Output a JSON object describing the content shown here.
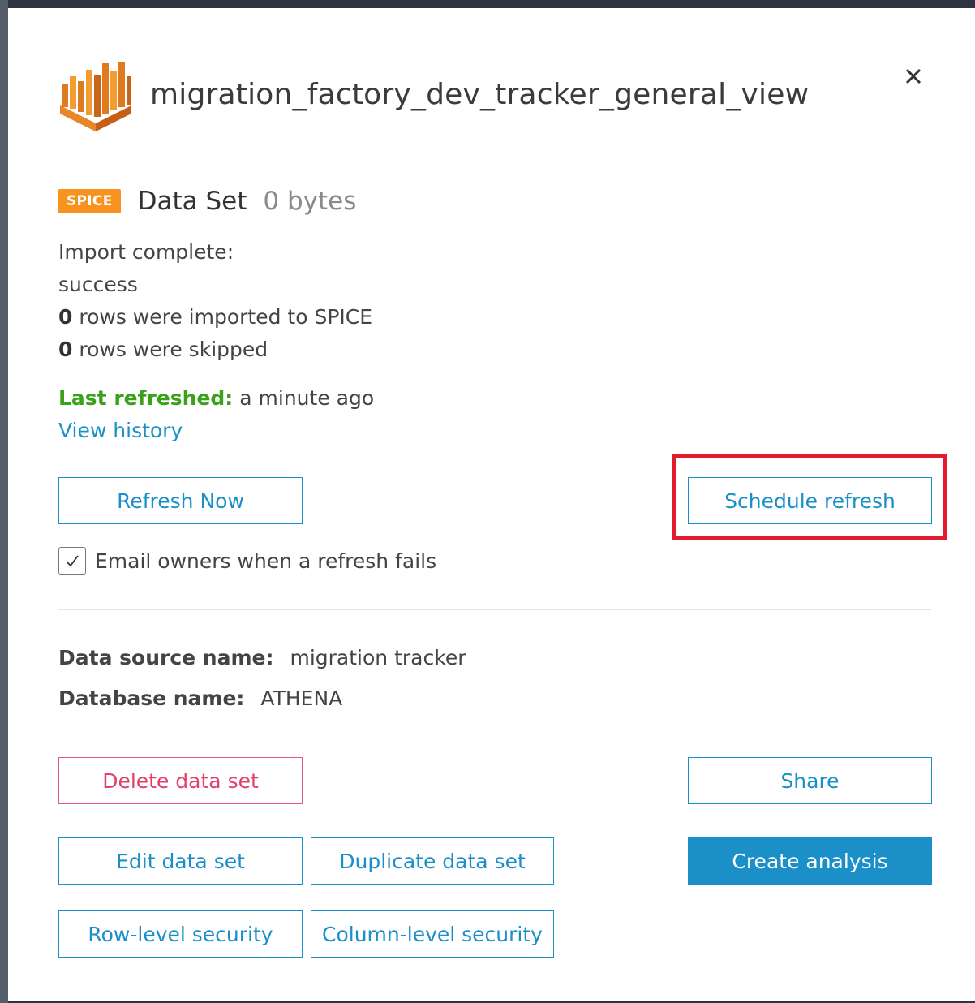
{
  "dialog": {
    "title": "migration_factory_dev_tracker_general_view",
    "close_icon": "close-icon",
    "logo_icon": "quicksight-logo-icon"
  },
  "dataset": {
    "badge": "SPICE",
    "label": "Data Set",
    "size": "0 bytes"
  },
  "import_status": {
    "heading": "Import complete:",
    "result": "success",
    "rows_imported_count": "0",
    "rows_imported_text": "rows were imported to SPICE",
    "rows_skipped_count": "0",
    "rows_skipped_text": "rows were skipped"
  },
  "refresh": {
    "last_refreshed_label": "Last refreshed:",
    "last_refreshed_value": "a minute ago",
    "view_history": "View history",
    "refresh_now": "Refresh Now",
    "schedule_refresh": "Schedule refresh",
    "email_owners_label": "Email owners when a refresh fails",
    "email_owners_checked": true
  },
  "source": {
    "data_source_label": "Data source name:",
    "data_source_value": "migration tracker",
    "database_label": "Database name:",
    "database_value": "ATHENA"
  },
  "actions": {
    "delete": "Delete data set",
    "share": "Share",
    "edit": "Edit data set",
    "duplicate": "Duplicate data set",
    "create_analysis": "Create analysis",
    "row_security": "Row-level security",
    "column_security": "Column-level security"
  },
  "colors": {
    "accent": "#1a8fc8",
    "spice_badge": "#f7931e",
    "success": "#3aa11b",
    "danger": "#e0406a",
    "highlight": "#e21c2d"
  }
}
